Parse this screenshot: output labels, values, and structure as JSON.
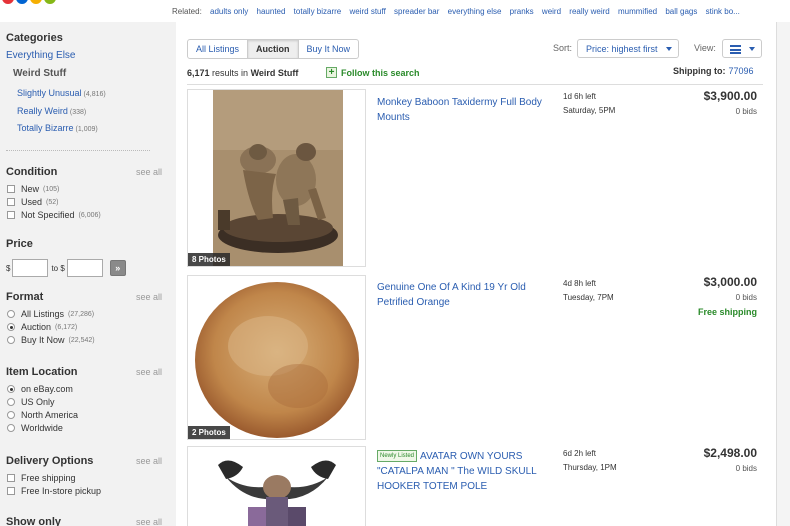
{
  "related": {
    "label": "Related:",
    "links": [
      "adults only",
      "haunted",
      "totally bizarre",
      "weird stuff",
      "spreader bar",
      "everything else",
      "pranks",
      "weird",
      "really weird",
      "mummified",
      "ball gags",
      "stink bo..."
    ]
  },
  "sidebar": {
    "categories_heading": "Categories",
    "parent_category": "Everything Else",
    "current_category": "Weird Stuff",
    "subcategories": [
      {
        "label": "Slightly Unusual",
        "count": "(4,816)"
      },
      {
        "label": "Really Weird",
        "count": "(338)"
      },
      {
        "label": "Totally Bizarre",
        "count": "(1,009)"
      }
    ],
    "see_all": "see all",
    "condition": {
      "heading": "Condition",
      "options": [
        {
          "label": "New",
          "count": "(105)"
        },
        {
          "label": "Used",
          "count": "(52)"
        },
        {
          "label": "Not Specified",
          "count": "(6,006)"
        }
      ]
    },
    "price": {
      "heading": "Price",
      "currency_from": "$",
      "to_label": "to $",
      "go_label": "»"
    },
    "format": {
      "heading": "Format",
      "options": [
        {
          "label": "All Listings",
          "count": "(27,286)",
          "selected": false
        },
        {
          "label": "Auction",
          "count": "(6,172)",
          "selected": true
        },
        {
          "label": "Buy It Now",
          "count": "(22,542)",
          "selected": false
        }
      ]
    },
    "location": {
      "heading": "Item Location",
      "options": [
        {
          "label": "on eBay.com",
          "selected": true
        },
        {
          "label": "US Only",
          "selected": false
        },
        {
          "label": "North America",
          "selected": false
        },
        {
          "label": "Worldwide",
          "selected": false
        }
      ]
    },
    "delivery": {
      "heading": "Delivery Options",
      "options": [
        {
          "label": "Free shipping"
        },
        {
          "label": "Free In-store pickup"
        }
      ]
    },
    "show_only_heading": "Show only"
  },
  "toolbar": {
    "tabs": [
      "All Listings",
      "Auction",
      "Buy It Now"
    ],
    "active_tab": "Auction",
    "sort_label": "Sort:",
    "sort_value": "Price: highest first",
    "view_label": "View:"
  },
  "results": {
    "count": "6,171",
    "in_text": "results in",
    "category": "Weird Stuff",
    "follow_label": "Follow this search",
    "shipping_to_label": "Shipping to:",
    "zip": "77096"
  },
  "items": [
    {
      "title": "Monkey Baboon Taxidermy Full Body Mounts",
      "time_left": "1d 6h left",
      "end_day": "Saturday, 5PM",
      "price": "$3,900.00",
      "bids": "0 bids",
      "photos": "8 Photos",
      "free_shipping": "",
      "newly_listed": ""
    },
    {
      "title": "Genuine One Of A Kind 19 Yr Old Petrified Orange",
      "time_left": "4d 8h left",
      "end_day": "Tuesday, 7PM",
      "price": "$3,000.00",
      "bids": "0 bids",
      "photos": "2 Photos",
      "free_shipping": "Free shipping",
      "newly_listed": ""
    },
    {
      "title": "AVATAR OWN YOURS \"CATALPA MAN \" The WILD SKULL HOOKER TOTEM POLE",
      "time_left": "6d 2h left",
      "end_day": "Thursday, 1PM",
      "price": "$2,498.00",
      "bids": "0 bids",
      "photos": "",
      "free_shipping": "",
      "newly_listed": "Newly Listed"
    }
  ],
  "colors": {
    "link": "#2a5db0",
    "green": "#2a8a2a",
    "sidebar_bg": "#f2f2f2"
  }
}
